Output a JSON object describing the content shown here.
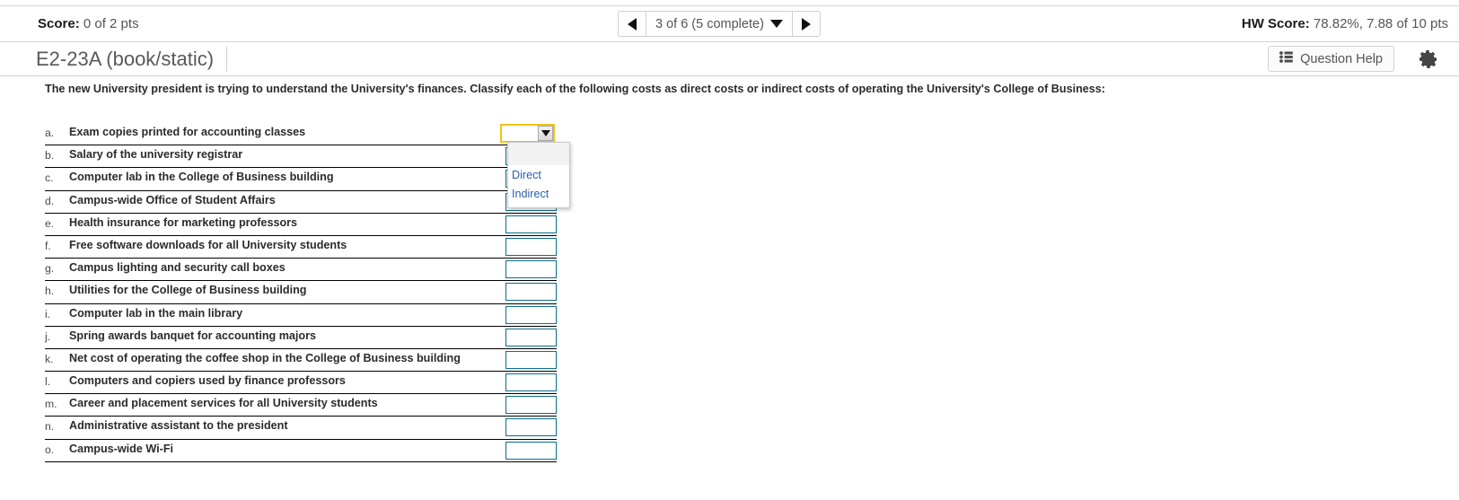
{
  "score_bar": {
    "score_label": "Score:",
    "score_value": "0 of 2 pts",
    "pager": {
      "prev_icon": "triangle-left-icon",
      "next_icon": "triangle-right-icon",
      "label": "3 of 6 (5 complete)",
      "caret_icon": "caret-down-icon"
    },
    "hw_score_label": "HW Score:",
    "hw_score_value": "78.82%, 7.88 of 10 pts"
  },
  "title_bar": {
    "title": "E2-23A (book/static)",
    "help_button": "Question Help",
    "help_icon": "bulleted-list-icon",
    "settings_icon": "gear-icon"
  },
  "question": {
    "prompt": "The new University president is trying to understand the University's finances. Classify each of the following costs as direct costs or indirect costs of operating the University's College of Business:",
    "items": [
      {
        "letter": "a.",
        "text": "Exam copies printed for accounting classes",
        "value": ""
      },
      {
        "letter": "b.",
        "text": "Salary of the university registrar",
        "value": ""
      },
      {
        "letter": "c.",
        "text": "Computer lab in the College of Business building",
        "value": ""
      },
      {
        "letter": "d.",
        "text": "Campus-wide Office of Student Affairs",
        "value": ""
      },
      {
        "letter": "e.",
        "text": "Health insurance for marketing professors",
        "value": ""
      },
      {
        "letter": "f.",
        "text": "Free software downloads for all University students",
        "value": ""
      },
      {
        "letter": "g.",
        "text": "Campus lighting and security call boxes",
        "value": ""
      },
      {
        "letter": "h.",
        "text": "Utilities for the College of Business building",
        "value": ""
      },
      {
        "letter": "i.",
        "text": "Computer lab in the main library",
        "value": ""
      },
      {
        "letter": "j.",
        "text": "Spring awards banquet for accounting majors",
        "value": ""
      },
      {
        "letter": "k.",
        "text": "Net cost of operating the coffee shop in the College of Business building",
        "value": ""
      },
      {
        "letter": "l.",
        "text": "Computers and copiers used by finance professors",
        "value": ""
      },
      {
        "letter": "m.",
        "text": "Career and placement services for all University students",
        "value": ""
      },
      {
        "letter": "n.",
        "text": "Administrative assistant to the president",
        "value": ""
      },
      {
        "letter": "o.",
        "text": "Campus-wide Wi-Fi",
        "value": ""
      }
    ]
  },
  "dropdown": {
    "open": true,
    "open_for_row": "a.",
    "selected": "",
    "options": [
      "",
      "Direct",
      "Indirect"
    ],
    "visible_options": [
      "Direct",
      "Indirect"
    ]
  },
  "colors": {
    "answer_box_border": "#0b6e8a",
    "focus_border": "#f0c419",
    "option_text": "#2b5fa8",
    "row_rule": "#000000",
    "title_text": "#58595b"
  }
}
